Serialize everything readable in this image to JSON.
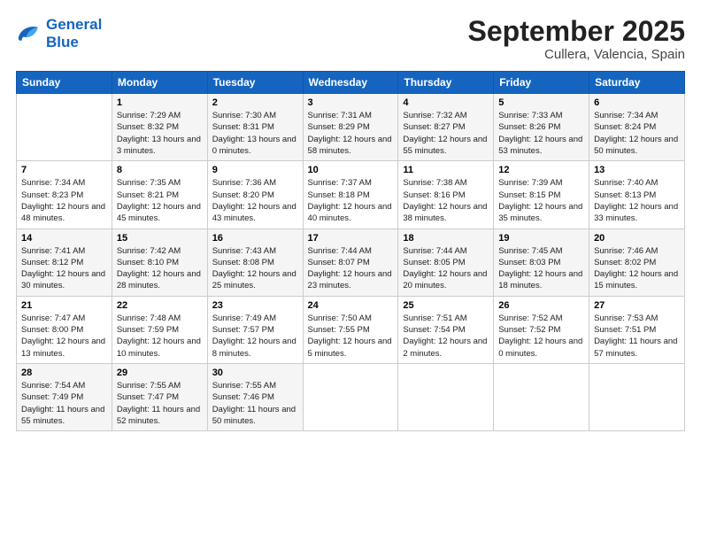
{
  "logo": {
    "line1": "General",
    "line2": "Blue"
  },
  "title": "September 2025",
  "subtitle": "Cullera, Valencia, Spain",
  "days_of_week": [
    "Sunday",
    "Monday",
    "Tuesday",
    "Wednesday",
    "Thursday",
    "Friday",
    "Saturday"
  ],
  "weeks": [
    [
      {
        "num": "",
        "sunrise": "",
        "sunset": "",
        "daylight": ""
      },
      {
        "num": "1",
        "sunrise": "Sunrise: 7:29 AM",
        "sunset": "Sunset: 8:32 PM",
        "daylight": "Daylight: 13 hours and 3 minutes."
      },
      {
        "num": "2",
        "sunrise": "Sunrise: 7:30 AM",
        "sunset": "Sunset: 8:31 PM",
        "daylight": "Daylight: 13 hours and 0 minutes."
      },
      {
        "num": "3",
        "sunrise": "Sunrise: 7:31 AM",
        "sunset": "Sunset: 8:29 PM",
        "daylight": "Daylight: 12 hours and 58 minutes."
      },
      {
        "num": "4",
        "sunrise": "Sunrise: 7:32 AM",
        "sunset": "Sunset: 8:27 PM",
        "daylight": "Daylight: 12 hours and 55 minutes."
      },
      {
        "num": "5",
        "sunrise": "Sunrise: 7:33 AM",
        "sunset": "Sunset: 8:26 PM",
        "daylight": "Daylight: 12 hours and 53 minutes."
      },
      {
        "num": "6",
        "sunrise": "Sunrise: 7:34 AM",
        "sunset": "Sunset: 8:24 PM",
        "daylight": "Daylight: 12 hours and 50 minutes."
      }
    ],
    [
      {
        "num": "7",
        "sunrise": "Sunrise: 7:34 AM",
        "sunset": "Sunset: 8:23 PM",
        "daylight": "Daylight: 12 hours and 48 minutes."
      },
      {
        "num": "8",
        "sunrise": "Sunrise: 7:35 AM",
        "sunset": "Sunset: 8:21 PM",
        "daylight": "Daylight: 12 hours and 45 minutes."
      },
      {
        "num": "9",
        "sunrise": "Sunrise: 7:36 AM",
        "sunset": "Sunset: 8:20 PM",
        "daylight": "Daylight: 12 hours and 43 minutes."
      },
      {
        "num": "10",
        "sunrise": "Sunrise: 7:37 AM",
        "sunset": "Sunset: 8:18 PM",
        "daylight": "Daylight: 12 hours and 40 minutes."
      },
      {
        "num": "11",
        "sunrise": "Sunrise: 7:38 AM",
        "sunset": "Sunset: 8:16 PM",
        "daylight": "Daylight: 12 hours and 38 minutes."
      },
      {
        "num": "12",
        "sunrise": "Sunrise: 7:39 AM",
        "sunset": "Sunset: 8:15 PM",
        "daylight": "Daylight: 12 hours and 35 minutes."
      },
      {
        "num": "13",
        "sunrise": "Sunrise: 7:40 AM",
        "sunset": "Sunset: 8:13 PM",
        "daylight": "Daylight: 12 hours and 33 minutes."
      }
    ],
    [
      {
        "num": "14",
        "sunrise": "Sunrise: 7:41 AM",
        "sunset": "Sunset: 8:12 PM",
        "daylight": "Daylight: 12 hours and 30 minutes."
      },
      {
        "num": "15",
        "sunrise": "Sunrise: 7:42 AM",
        "sunset": "Sunset: 8:10 PM",
        "daylight": "Daylight: 12 hours and 28 minutes."
      },
      {
        "num": "16",
        "sunrise": "Sunrise: 7:43 AM",
        "sunset": "Sunset: 8:08 PM",
        "daylight": "Daylight: 12 hours and 25 minutes."
      },
      {
        "num": "17",
        "sunrise": "Sunrise: 7:44 AM",
        "sunset": "Sunset: 8:07 PM",
        "daylight": "Daylight: 12 hours and 23 minutes."
      },
      {
        "num": "18",
        "sunrise": "Sunrise: 7:44 AM",
        "sunset": "Sunset: 8:05 PM",
        "daylight": "Daylight: 12 hours and 20 minutes."
      },
      {
        "num": "19",
        "sunrise": "Sunrise: 7:45 AM",
        "sunset": "Sunset: 8:03 PM",
        "daylight": "Daylight: 12 hours and 18 minutes."
      },
      {
        "num": "20",
        "sunrise": "Sunrise: 7:46 AM",
        "sunset": "Sunset: 8:02 PM",
        "daylight": "Daylight: 12 hours and 15 minutes."
      }
    ],
    [
      {
        "num": "21",
        "sunrise": "Sunrise: 7:47 AM",
        "sunset": "Sunset: 8:00 PM",
        "daylight": "Daylight: 12 hours and 13 minutes."
      },
      {
        "num": "22",
        "sunrise": "Sunrise: 7:48 AM",
        "sunset": "Sunset: 7:59 PM",
        "daylight": "Daylight: 12 hours and 10 minutes."
      },
      {
        "num": "23",
        "sunrise": "Sunrise: 7:49 AM",
        "sunset": "Sunset: 7:57 PM",
        "daylight": "Daylight: 12 hours and 8 minutes."
      },
      {
        "num": "24",
        "sunrise": "Sunrise: 7:50 AM",
        "sunset": "Sunset: 7:55 PM",
        "daylight": "Daylight: 12 hours and 5 minutes."
      },
      {
        "num": "25",
        "sunrise": "Sunrise: 7:51 AM",
        "sunset": "Sunset: 7:54 PM",
        "daylight": "Daylight: 12 hours and 2 minutes."
      },
      {
        "num": "26",
        "sunrise": "Sunrise: 7:52 AM",
        "sunset": "Sunset: 7:52 PM",
        "daylight": "Daylight: 12 hours and 0 minutes."
      },
      {
        "num": "27",
        "sunrise": "Sunrise: 7:53 AM",
        "sunset": "Sunset: 7:51 PM",
        "daylight": "Daylight: 11 hours and 57 minutes."
      }
    ],
    [
      {
        "num": "28",
        "sunrise": "Sunrise: 7:54 AM",
        "sunset": "Sunset: 7:49 PM",
        "daylight": "Daylight: 11 hours and 55 minutes."
      },
      {
        "num": "29",
        "sunrise": "Sunrise: 7:55 AM",
        "sunset": "Sunset: 7:47 PM",
        "daylight": "Daylight: 11 hours and 52 minutes."
      },
      {
        "num": "30",
        "sunrise": "Sunrise: 7:55 AM",
        "sunset": "Sunset: 7:46 PM",
        "daylight": "Daylight: 11 hours and 50 minutes."
      },
      {
        "num": "",
        "sunrise": "",
        "sunset": "",
        "daylight": ""
      },
      {
        "num": "",
        "sunrise": "",
        "sunset": "",
        "daylight": ""
      },
      {
        "num": "",
        "sunrise": "",
        "sunset": "",
        "daylight": ""
      },
      {
        "num": "",
        "sunrise": "",
        "sunset": "",
        "daylight": ""
      }
    ]
  ]
}
